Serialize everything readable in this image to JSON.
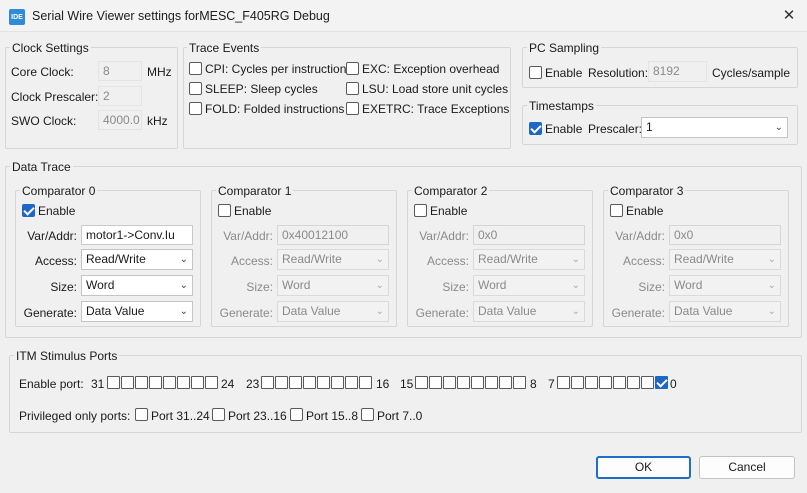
{
  "window": {
    "title": "Serial Wire Viewer settings forMESC_F405RG Debug",
    "app_icon": "IDE",
    "close": "✕"
  },
  "clock": {
    "legend": "Clock Settings",
    "core_clock_label": "Core Clock:",
    "core_clock_value": "8",
    "core_clock_unit": "MHz",
    "prescaler_label": "Clock Prescaler:",
    "prescaler_value": "2",
    "swo_label": "SWO Clock:",
    "swo_value": "4000.0",
    "swo_unit": "kHz"
  },
  "trace": {
    "legend": "Trace Events",
    "events": [
      {
        "label": "CPI: Cycles per instruction",
        "checked": false
      },
      {
        "label": "SLEEP: Sleep cycles",
        "checked": false
      },
      {
        "label": "FOLD: Folded instructions",
        "checked": false
      },
      {
        "label": "EXC: Exception overhead",
        "checked": false
      },
      {
        "label": "LSU: Load store unit cycles",
        "checked": false
      },
      {
        "label": "EXETRC: Trace Exceptions",
        "checked": false
      }
    ]
  },
  "pc_sampling": {
    "legend": "PC Sampling",
    "enable_label": "Enable",
    "enabled": false,
    "resolution_label": "Resolution:",
    "resolution_value": "8192",
    "unit": "Cycles/sample"
  },
  "timestamps": {
    "legend": "Timestamps",
    "enable_label": "Enable",
    "enabled": true,
    "prescaler_label": "Prescaler:",
    "prescaler_value": "1"
  },
  "data_trace": {
    "legend": "Data Trace",
    "field_labels": {
      "enable": "Enable",
      "var": "Var/Addr:",
      "access": "Access:",
      "size": "Size:",
      "generate": "Generate:"
    },
    "comparators": [
      {
        "title": "Comparator 0",
        "enabled": true,
        "var": "motor1->Conv.Iu",
        "access": "Read/Write",
        "size": "Word",
        "generate": "Data Value"
      },
      {
        "title": "Comparator 1",
        "enabled": false,
        "var": "0x40012100",
        "access": "Read/Write",
        "size": "Word",
        "generate": "Data Value"
      },
      {
        "title": "Comparator 2",
        "enabled": false,
        "var": "0x0",
        "access": "Read/Write",
        "size": "Word",
        "generate": "Data Value"
      },
      {
        "title": "Comparator 3",
        "enabled": false,
        "var": "0x0",
        "access": "Read/Write",
        "size": "Word",
        "generate": "Data Value"
      }
    ]
  },
  "itm": {
    "legend": "ITM Stimulus Ports",
    "enable_label": "Enable port:",
    "port_groups": [
      {
        "hi": "31",
        "lo": "24",
        "checked": [
          false,
          false,
          false,
          false,
          false,
          false,
          false,
          false
        ]
      },
      {
        "hi": "23",
        "lo": "16",
        "checked": [
          false,
          false,
          false,
          false,
          false,
          false,
          false,
          false
        ]
      },
      {
        "hi": "15",
        "lo": "8",
        "checked": [
          false,
          false,
          false,
          false,
          false,
          false,
          false,
          false
        ]
      },
      {
        "hi": "7",
        "lo": "0",
        "checked": [
          false,
          false,
          false,
          false,
          false,
          false,
          false,
          true
        ]
      }
    ],
    "privileged_label": "Privileged only ports:",
    "privileged": [
      {
        "label": "Port 31..24",
        "checked": false
      },
      {
        "label": "Port 23..16",
        "checked": false
      },
      {
        "label": "Port 15..8",
        "checked": false
      },
      {
        "label": "Port 7..0",
        "checked": false
      }
    ]
  },
  "buttons": {
    "ok": "OK",
    "cancel": "Cancel"
  },
  "colors": {
    "accent": "#1f67c7",
    "default_button_border": "#1e6ec8"
  }
}
